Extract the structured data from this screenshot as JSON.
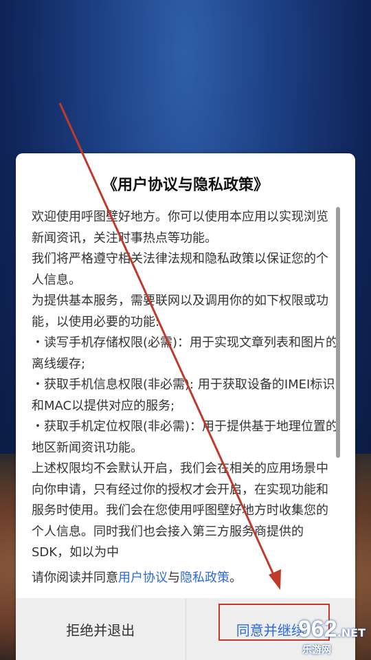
{
  "dialog": {
    "title": "《用户协议与隐私政策》",
    "paragraphs": [
      "欢迎使用呼图壁好地方。你可以使用本应用以实现浏览新闻资讯，关注时事热点等功能。",
      "我们将严格遵守相关法律法规和隐私政策以保证您的个人信息。",
      "为提供基本服务，需要联网以及调用你的如下权限或功能，以使用必要的功能:",
      "  ・读写手机存储权限(必需)：用于实现文章列表和图片的离线缓存;",
      "  ・获取手机信息权限(非必需): 用于获取设备的IMEI标识和MAC以提供对应的服务;",
      "  ・获取手机定位权限(非必需)：用于提供基于地理位置的地区新闻资讯功能。",
      "上述权限均不会默认开启，我们会在相关的应用场景中向你申请，只有经过你的授权才会开启，在实现功能和服务时使用。我们会在您使用呼图壁好地方时收集您的个人信息。同时我们也会接入第三方服务商提供的SDK，如以为中"
    ],
    "consent": {
      "prefix": "请你阅读并同意",
      "link1": "用户协议",
      "middle": "与",
      "link2": "隐私政策",
      "suffix": "。"
    },
    "buttons": {
      "decline": "拒绝并退出",
      "accept": "同意并继续"
    }
  },
  "watermark": {
    "number": "962",
    "suffix": ".NET",
    "site": "乐游网"
  },
  "colors": {
    "link": "#2c6bd6",
    "annotation": "#c0392b"
  }
}
